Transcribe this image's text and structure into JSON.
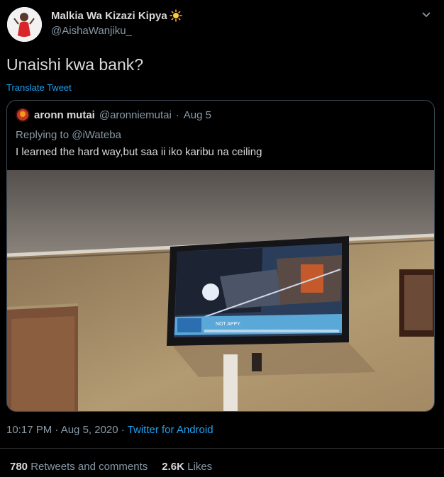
{
  "author": {
    "display_name": "Malkia Wa Kizazi Kipya",
    "emoji_icon": "sun-emoji-icon",
    "handle": "@AishaWanjiku_"
  },
  "tweet": {
    "text": "Unaishi kwa bank?",
    "translate_label": "Translate Tweet"
  },
  "quoted": {
    "display_name": "aronn mutai",
    "handle": "@aronniemutai",
    "separator": "·",
    "date": "Aug 5",
    "replying_prefix": "Replying to ",
    "replying_to": "@iWateba",
    "text": "I learned the hard way,but saa ii iko karibu na ceiling",
    "photo_tv_text": "NOT APPY"
  },
  "meta": {
    "timestamp": "10:17 PM · Aug 5, 2020 · ",
    "source": "Twitter for Android"
  },
  "stats": {
    "retweets_count": "780",
    "retweets_label": "Retweets and comments",
    "likes_count": "2.6K",
    "likes_label": "Likes"
  },
  "colors": {
    "background": "#000000",
    "link": "#1da1f2",
    "secondary_text": "#8899a6",
    "primary_text": "#d9d9d9"
  }
}
